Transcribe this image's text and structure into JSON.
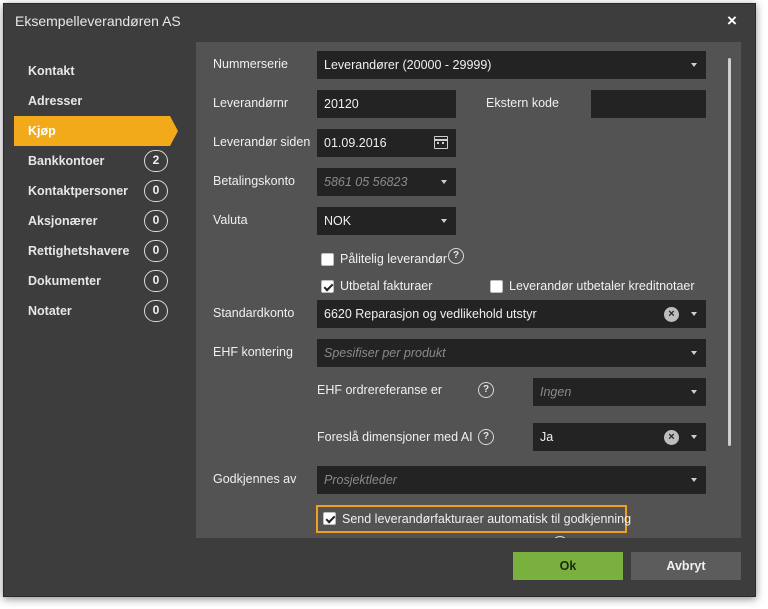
{
  "dialog": {
    "title": "Eksempelleverandøren AS",
    "close_glyph": "×"
  },
  "sidebar": {
    "items": [
      {
        "label": "Kontakt",
        "badge": ""
      },
      {
        "label": "Adresser",
        "badge": ""
      },
      {
        "label": "Kjøp",
        "badge": "",
        "active": true
      },
      {
        "label": "Bankkontoer",
        "badge": "2"
      },
      {
        "label": "Kontaktpersoner",
        "badge": "0"
      },
      {
        "label": "Aksjonærer",
        "badge": "0"
      },
      {
        "label": "Rettighetshavere",
        "badge": "0"
      },
      {
        "label": "Dokumenter",
        "badge": "0"
      },
      {
        "label": "Notater",
        "badge": "0"
      }
    ]
  },
  "form": {
    "nummerserie": {
      "label": "Nummerserie",
      "value": "Leverandører (20000 - 29999)"
    },
    "leverandornr": {
      "label": "Leverandørnr",
      "value": "20120"
    },
    "ekstern_kode": {
      "label": "Ekstern kode",
      "value": ""
    },
    "leverandor_siden": {
      "label": "Leverandør siden",
      "value": "01.09.2016"
    },
    "betalingskonto": {
      "label": "Betalingskonto",
      "placeholder": "5861 05 56823"
    },
    "valuta": {
      "label": "Valuta",
      "value": "NOK"
    },
    "palitelig": {
      "label": "Pålitelig leverandør",
      "checked": false
    },
    "utbetal": {
      "label": "Utbetal fakturaer",
      "checked": true
    },
    "kreditnotaer": {
      "label": "Leverandør utbetaler kreditnotaer",
      "checked": false
    },
    "standardkonto": {
      "label": "Standardkonto",
      "value": "6620 Reparasjon og vedlikehold utstyr"
    },
    "ehf_kontering": {
      "label": "EHF kontering",
      "placeholder": "Spesifiser per produkt"
    },
    "ehf_ordrereferanse": {
      "label": "EHF ordrereferanse er",
      "placeholder": "Ingen"
    },
    "foresla": {
      "label": "Foreslå dimensjoner med AI",
      "value": "Ja"
    },
    "godkjennes": {
      "label": "Godkjennes av",
      "placeholder": "Prosjektleder"
    },
    "send_auto": {
      "label": "Send leverandørfakturaer automatisk til godkjenning",
      "checked": true
    }
  },
  "glyphs": {
    "help": "?",
    "clear": "×"
  },
  "footer": {
    "ok_label": "Ok",
    "cancel_label": "Avbryt"
  },
  "colors": {
    "accent": "#f2aa1b",
    "ok": "#79b03e",
    "highlight": "#f0a01a"
  },
  "icons": {
    "close": "close-icon",
    "calendar": "calendar-icon",
    "dropdown": "chevron-down-icon",
    "help": "help-icon",
    "clear": "clear-icon",
    "checkbox": "checkbox-icon"
  }
}
